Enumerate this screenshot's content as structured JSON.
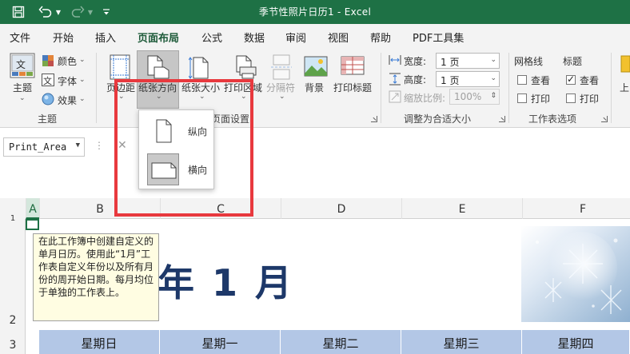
{
  "titlebar": {
    "title": "季节性照片日历1 - Excel",
    "bg_color": "#1e7145"
  },
  "menu": {
    "tabs": [
      "文件",
      "开始",
      "插入",
      "页面布局",
      "公式",
      "数据",
      "审阅",
      "视图",
      "帮助",
      "PDF工具集"
    ],
    "active": "页面布局"
  },
  "ribbon": {
    "theme": {
      "themes_label": "主题",
      "colors_label": "颜色",
      "fonts_label": "字体",
      "effects_label": "效果",
      "group_label": "主题"
    },
    "page_setup": {
      "margins_label": "页边距",
      "orientation_label": "纸张方向",
      "size_label": "纸张大小",
      "print_area_label": "打印区域",
      "breaks_label": "分隔符",
      "background_label": "背景",
      "print_titles_label": "打印标题",
      "group_label": "页面设置"
    },
    "scale": {
      "width_label": "宽度:",
      "width_value": "1 页",
      "height_label": "高度:",
      "height_value": "1 页",
      "scale_label": "缩放比例:",
      "scale_value": "100%",
      "group_label": "调整为合适大小"
    },
    "sheet_options": {
      "gridlines_label": "网格线",
      "headings_label": "标题",
      "view_label": "查看",
      "print_label": "打印",
      "gridlines_view_checked": false,
      "gridlines_print_checked": false,
      "headings_view_checked": true,
      "headings_print_checked": false,
      "group_label": "工作表选项"
    },
    "arrange_partial": "上"
  },
  "orientation_popup": {
    "portrait_label": "纵向",
    "landscape_label": "横向",
    "selected": "横向"
  },
  "formula_bar": {
    "name_box": "Print_Area"
  },
  "sheet": {
    "columns": [
      "A",
      "B",
      "C",
      "D",
      "E",
      "F"
    ],
    "active_column": "A",
    "rows": [
      "1",
      "2",
      "3"
    ],
    "tooltip_text": "在此工作簿中创建自定义的单月日历。使用此“1月”工作表自定义年份以及所有月份的周开始日期。每月均位于单独的工作表上。",
    "big_title": "年 1 月",
    "weekdays": [
      "星期日",
      "星期一",
      "星期二",
      "星期三",
      "星期四"
    ],
    "header_fill_color": "#b3c7e6",
    "title_color": "#1d3869"
  },
  "highlight_color": "#e8393e"
}
